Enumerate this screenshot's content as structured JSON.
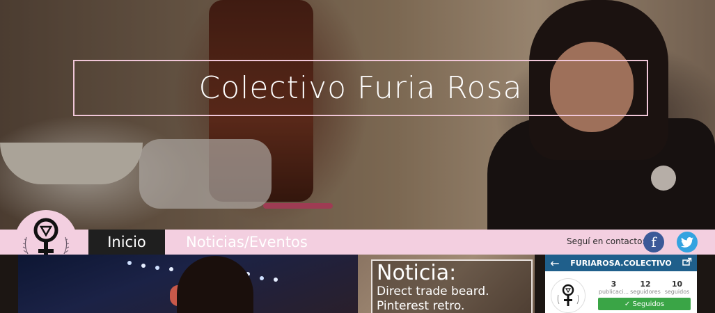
{
  "header": {
    "title": "Colectivo Furia Rosa"
  },
  "nav": {
    "items": [
      {
        "label": "Inicio",
        "active": true
      },
      {
        "label": "Noticias/Eventos",
        "active": false
      }
    ],
    "contact_label": "Seguí en contacto:",
    "social": [
      {
        "name": "facebook",
        "glyph": "f",
        "color": "#3b5998"
      },
      {
        "name": "twitter",
        "color": "#34a3e0"
      }
    ]
  },
  "news": {
    "heading": "Noticia:",
    "lines": [
      "Direct trade beard.",
      "Pinterest retro."
    ]
  },
  "instagram": {
    "back_icon": "arrow-left-icon",
    "username": "FURIAROSA.COLECTIVO",
    "share_icon": "share-icon",
    "stats": [
      {
        "value": "3",
        "label": "publicaci..."
      },
      {
        "value": "12",
        "label": "seguidores"
      },
      {
        "value": "10",
        "label": "seguidos"
      }
    ],
    "follow_label": "✓ Seguidos"
  },
  "colors": {
    "accent_pink": "#f3cfe0",
    "nav_active": "#1f1f1f",
    "instagram_header": "#1f5f8b",
    "follow_green": "#3aa546"
  }
}
